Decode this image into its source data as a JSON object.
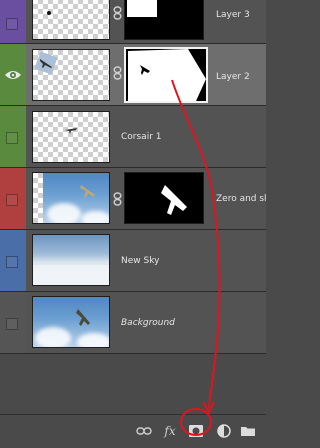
{
  "layers": [
    {
      "name": "Layer 3",
      "strip_color": "#6a4fa0",
      "visible": false,
      "italic": false,
      "has_mask": true,
      "mask_selected": false,
      "thumb": "transparent",
      "selected": false
    },
    {
      "name": "Layer 2",
      "strip_color": "#5a8a3e",
      "visible": true,
      "italic": false,
      "has_mask": true,
      "mask_selected": true,
      "thumb": "transparent",
      "selected": true
    },
    {
      "name": "Corsair 1",
      "strip_color": "#5a8a3e",
      "visible": false,
      "italic": false,
      "has_mask": false,
      "thumb": "transparent",
      "selected": false
    },
    {
      "name": "Zero and sk",
      "strip_color": "#b04040",
      "visible": false,
      "italic": false,
      "has_mask": true,
      "mask_selected": false,
      "thumb": "sky",
      "selected": false
    },
    {
      "name": "New Sky",
      "strip_color": "#4a6ea8",
      "visible": false,
      "italic": false,
      "has_mask": false,
      "thumb": "sky-pan",
      "selected": false
    },
    {
      "name": "Background",
      "strip_color": "#555555",
      "visible": false,
      "italic": true,
      "has_mask": false,
      "thumb": "sky",
      "selected": false
    }
  ],
  "toolbar": {
    "buttons": [
      {
        "icon": "link-icon",
        "label": ""
      },
      {
        "icon": "fx-icon",
        "label": "fx"
      },
      {
        "icon": "add-mask-icon",
        "label": ""
      },
      {
        "icon": "adjustment-layer-icon",
        "label": ""
      },
      {
        "icon": "folder-icon",
        "label": ""
      }
    ]
  },
  "colors": {
    "panel_bg": "#535353",
    "selected_bg": "#6e6e6e",
    "annotation": "#e0141e"
  }
}
